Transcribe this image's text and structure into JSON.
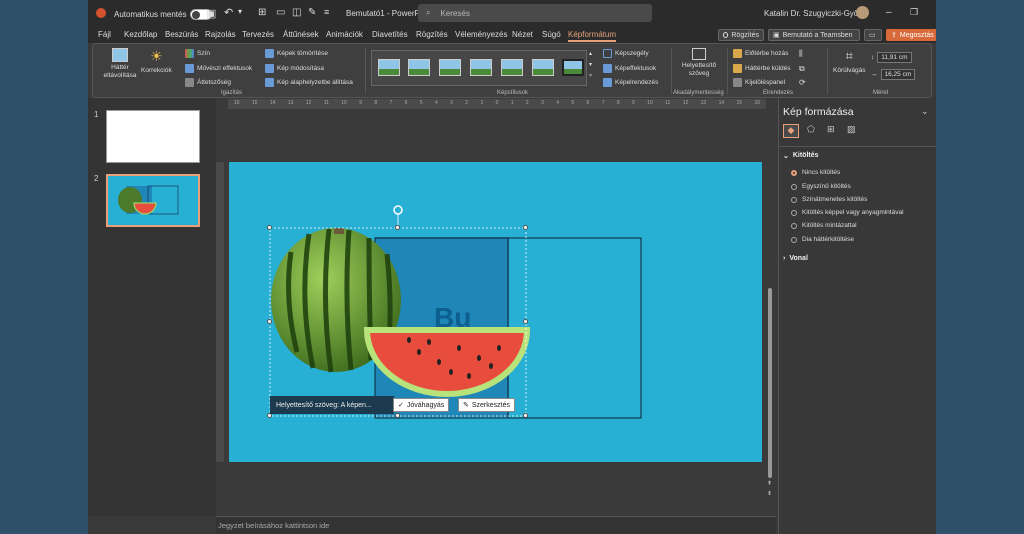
{
  "titlebar": {
    "autosave_label": "Automatikus mentés",
    "doc_title": "Bemutató1 - PowerP...",
    "search_placeholder": "Keresés",
    "user_name": "Katalin Dr. Szugyiczki-Győrfi"
  },
  "menu": {
    "items": [
      "Fájl",
      "Kezdőlap",
      "Beszúrás",
      "Rajzolás",
      "Tervezés",
      "Áttűnések",
      "Animációk",
      "Diavetítés",
      "Rögzítés",
      "Véleményezés",
      "Nézet",
      "Súgó",
      "Képformátum"
    ],
    "active": "Képformátum",
    "record_button": "Rögzítés",
    "teams_button": "Bemutató a Teamsben",
    "share_button": "Megosztás"
  },
  "ribbon": {
    "remove_bg": "Háttér eltávolítása",
    "corrections": "Korrekciók",
    "color": "Szín",
    "artistic": "Művészi effektusok",
    "transparency": "Áttetszőség",
    "compress": "Képek tömörítése",
    "change_picture": "Kép módosítása",
    "reset_picture": "Kép alaphelyzetbe állítása",
    "adjust_group": "Igazítás",
    "picture_border": "Képszegély",
    "picture_effects": "Képeffektusok",
    "picture_layout": "Képelrendezés",
    "styles_group": "Képstílusok",
    "alt_text": "Helyettesítő szöveg",
    "accessibility_group": "Akadálymentesség",
    "bring_forward": "Előtérbe hozás",
    "send_backward": "Háttérbe küldés",
    "selection_pane": "Kijelöléspanel",
    "arrange_group": "Elrendezés",
    "crop": "Körülvágás",
    "height": "11,91 cm",
    "width": "16,25 cm",
    "size_group": "Méret"
  },
  "slides": {
    "numbers": [
      "1",
      "2"
    ]
  },
  "ruler_ticks": [
    "16",
    "15",
    "14",
    "13",
    "12",
    "11",
    "10",
    "9",
    "8",
    "7",
    "6",
    "5",
    "4",
    "3",
    "2",
    "1",
    "0",
    "1",
    "2",
    "3",
    "4",
    "5",
    "6",
    "7",
    "8",
    "9",
    "10",
    "11",
    "12",
    "13",
    "14",
    "15",
    "16"
  ],
  "canvas": {
    "alt_text_preview": "Helyettesítő szöveg: A képen...",
    "approve_button": "Jóváhagyás",
    "edit_button": "Szerkesztés",
    "bg_logo_text": "Bu"
  },
  "notes_placeholder": "Jegyzet beírásához kattintson ide",
  "format_pane": {
    "title": "Kép formázása",
    "fill_section": "Kitöltés",
    "options": [
      "Nincs kitöltés",
      "Egyszínű kitöltés",
      "Színátmenetes kitöltés",
      "Kitöltés képpel vagy anyagmintával",
      "Kitöltés mintázattal",
      "Dia háttérkitöltése"
    ],
    "selected_option": "Nincs kitöltés",
    "line_section": "Vonal"
  },
  "colors": {
    "accent": "#e8a07a",
    "canvas_bg": "#27b0d4",
    "share_bg": "#d86a3a"
  }
}
